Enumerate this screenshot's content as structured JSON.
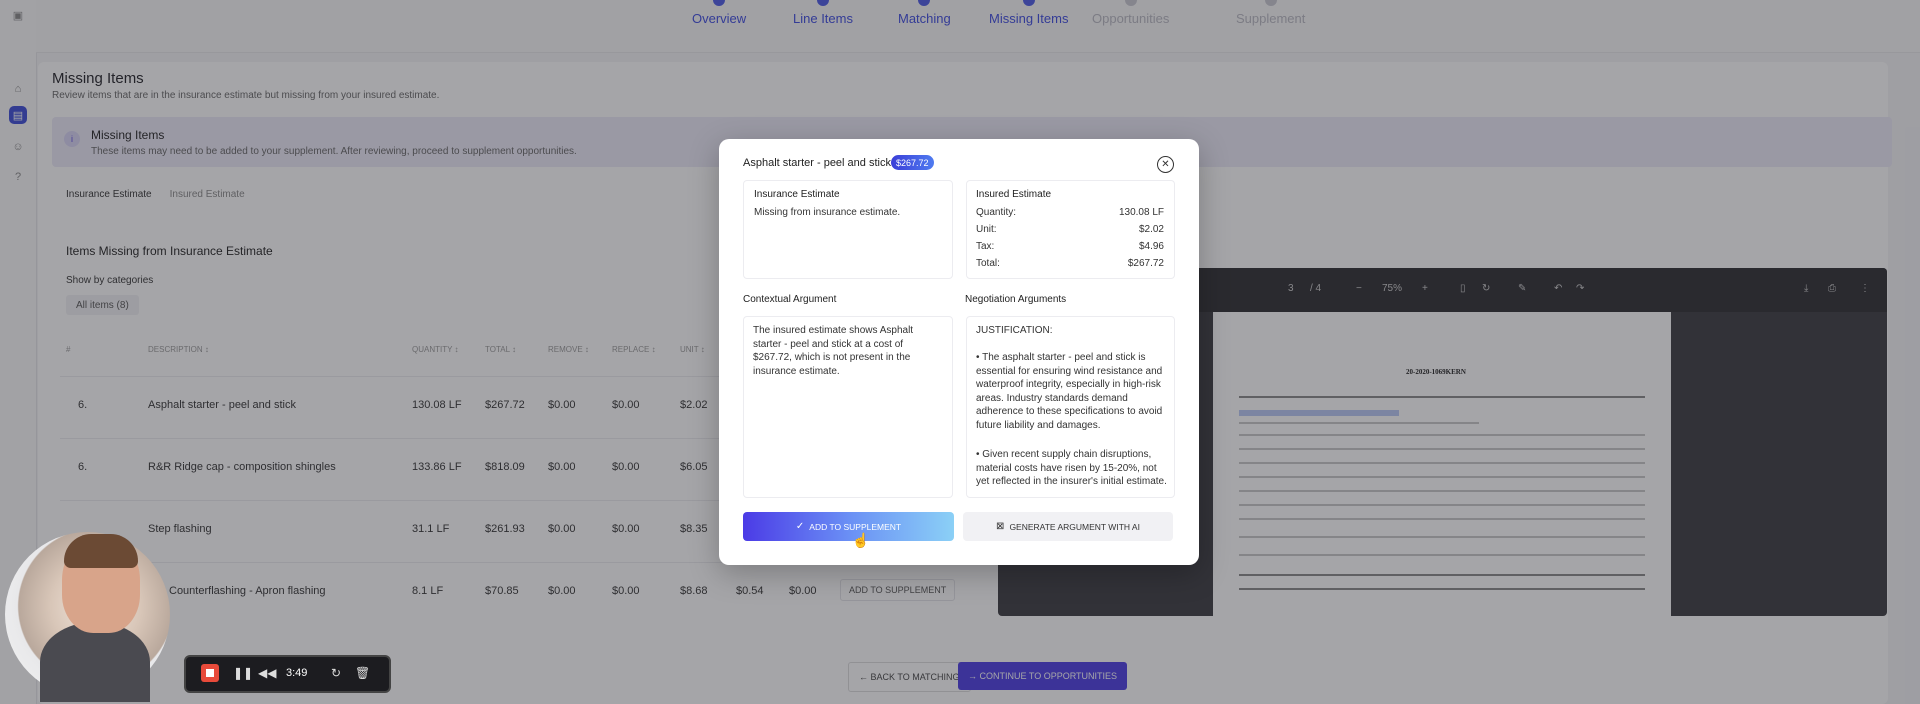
{
  "nav": {
    "steps": [
      {
        "label": "Overview",
        "state": "done"
      },
      {
        "label": "Line Items",
        "state": "done"
      },
      {
        "label": "Matching",
        "state": "done"
      },
      {
        "label": "Missing Items",
        "state": "current"
      },
      {
        "label": "Opportunities",
        "state": "todo"
      },
      {
        "label": "Supplement",
        "state": "todo"
      }
    ]
  },
  "page": {
    "title": "Missing Items",
    "subtitle": "Review items that are in the insurance estimate but missing from your insured estimate."
  },
  "banner": {
    "title": "Missing Items",
    "text": "These items may need to be added to your supplement. After reviewing, proceed to supplement opportunities."
  },
  "tabs": [
    "Insurance Estimate",
    "Insured Estimate"
  ],
  "section": {
    "title": "Items Missing from Insurance Estimate",
    "show_by": "Show by categories",
    "all_items": "All items (8)"
  },
  "table": {
    "headers": [
      "#",
      "DESCRIPTION ↕",
      "QUANTITY ↕",
      "TOTAL ↕",
      "REMOVE ↕",
      "REPLACE ↕",
      "UNIT ↕"
    ],
    "rows": [
      {
        "num": "6.",
        "desc": "Asphalt starter - peel and stick",
        "qty": "130.08 LF",
        "total": "$267.72",
        "remove": "$0.00",
        "replace": "$0.00",
        "unit": "$2.02"
      },
      {
        "num": "6.",
        "desc": "R&R Ridge cap - composition shingles",
        "qty": "133.86 LF",
        "total": "$818.09",
        "remove": "$0.00",
        "replace": "$0.00",
        "unit": "$6.05"
      },
      {
        "num": "",
        "desc": "Step flashing",
        "qty": "31.1 LF",
        "total": "$261.93",
        "remove": "$0.00",
        "replace": "$0.00",
        "unit": "$8.35"
      },
      {
        "num": "",
        "desc": "Counterflashing - Apron flashing",
        "qty": "8.1 LF",
        "total": "$70.85",
        "remove": "$0.00",
        "replace": "$0.00",
        "unit": "$8.68",
        "tax": "$0.54",
        "extra": "$0.00",
        "button": "ADD TO SUPPLEMENT"
      }
    ]
  },
  "pdf": {
    "page": "3",
    "pages": "/ 4",
    "zoom": "75%",
    "doc_title": "20-2020-1069KERN"
  },
  "footer": {
    "back": "BACK TO MATCHING",
    "continue": "CONTINUE TO OPPORTUNITIES"
  },
  "modal": {
    "title": "Asphalt starter - peel and stick",
    "badge": "$267.72",
    "insurance": {
      "title": "Insurance Estimate",
      "text": "Missing from insurance estimate."
    },
    "insured": {
      "title": "Insured Estimate",
      "rows": [
        {
          "k": "Quantity:",
          "v": "130.08 LF"
        },
        {
          "k": "Unit:",
          "v": "$2.02"
        },
        {
          "k": "Tax:",
          "v": "$4.96"
        },
        {
          "k": "Total:",
          "v": "$267.72"
        }
      ]
    },
    "contextual": {
      "label": "Contextual Argument",
      "text": "The insured estimate shows Asphalt starter - peel and stick at a cost of $267.72, which is not present in the insurance estimate."
    },
    "negotiation": {
      "label": "Negotiation Arguments",
      "heading": "JUSTIFICATION:",
      "p1": "• The asphalt starter - peel and stick is essential for ensuring wind resistance and waterproof integrity, especially in high-risk areas. Industry standards demand adherence to these specifications to avoid future liability and damages.",
      "p2": "• Given recent supply chain disruptions, material costs have risen by 15-20%, not yet reflected in the insurer's initial estimate."
    },
    "add_button": "ADD TO SUPPLEMENT",
    "generate_button": "GENERATE ARGUMENT WITH AI"
  },
  "recorder": {
    "time": "3:49"
  },
  "colors": {
    "accent": "#3d4ae0",
    "record": "#e84a3a"
  }
}
